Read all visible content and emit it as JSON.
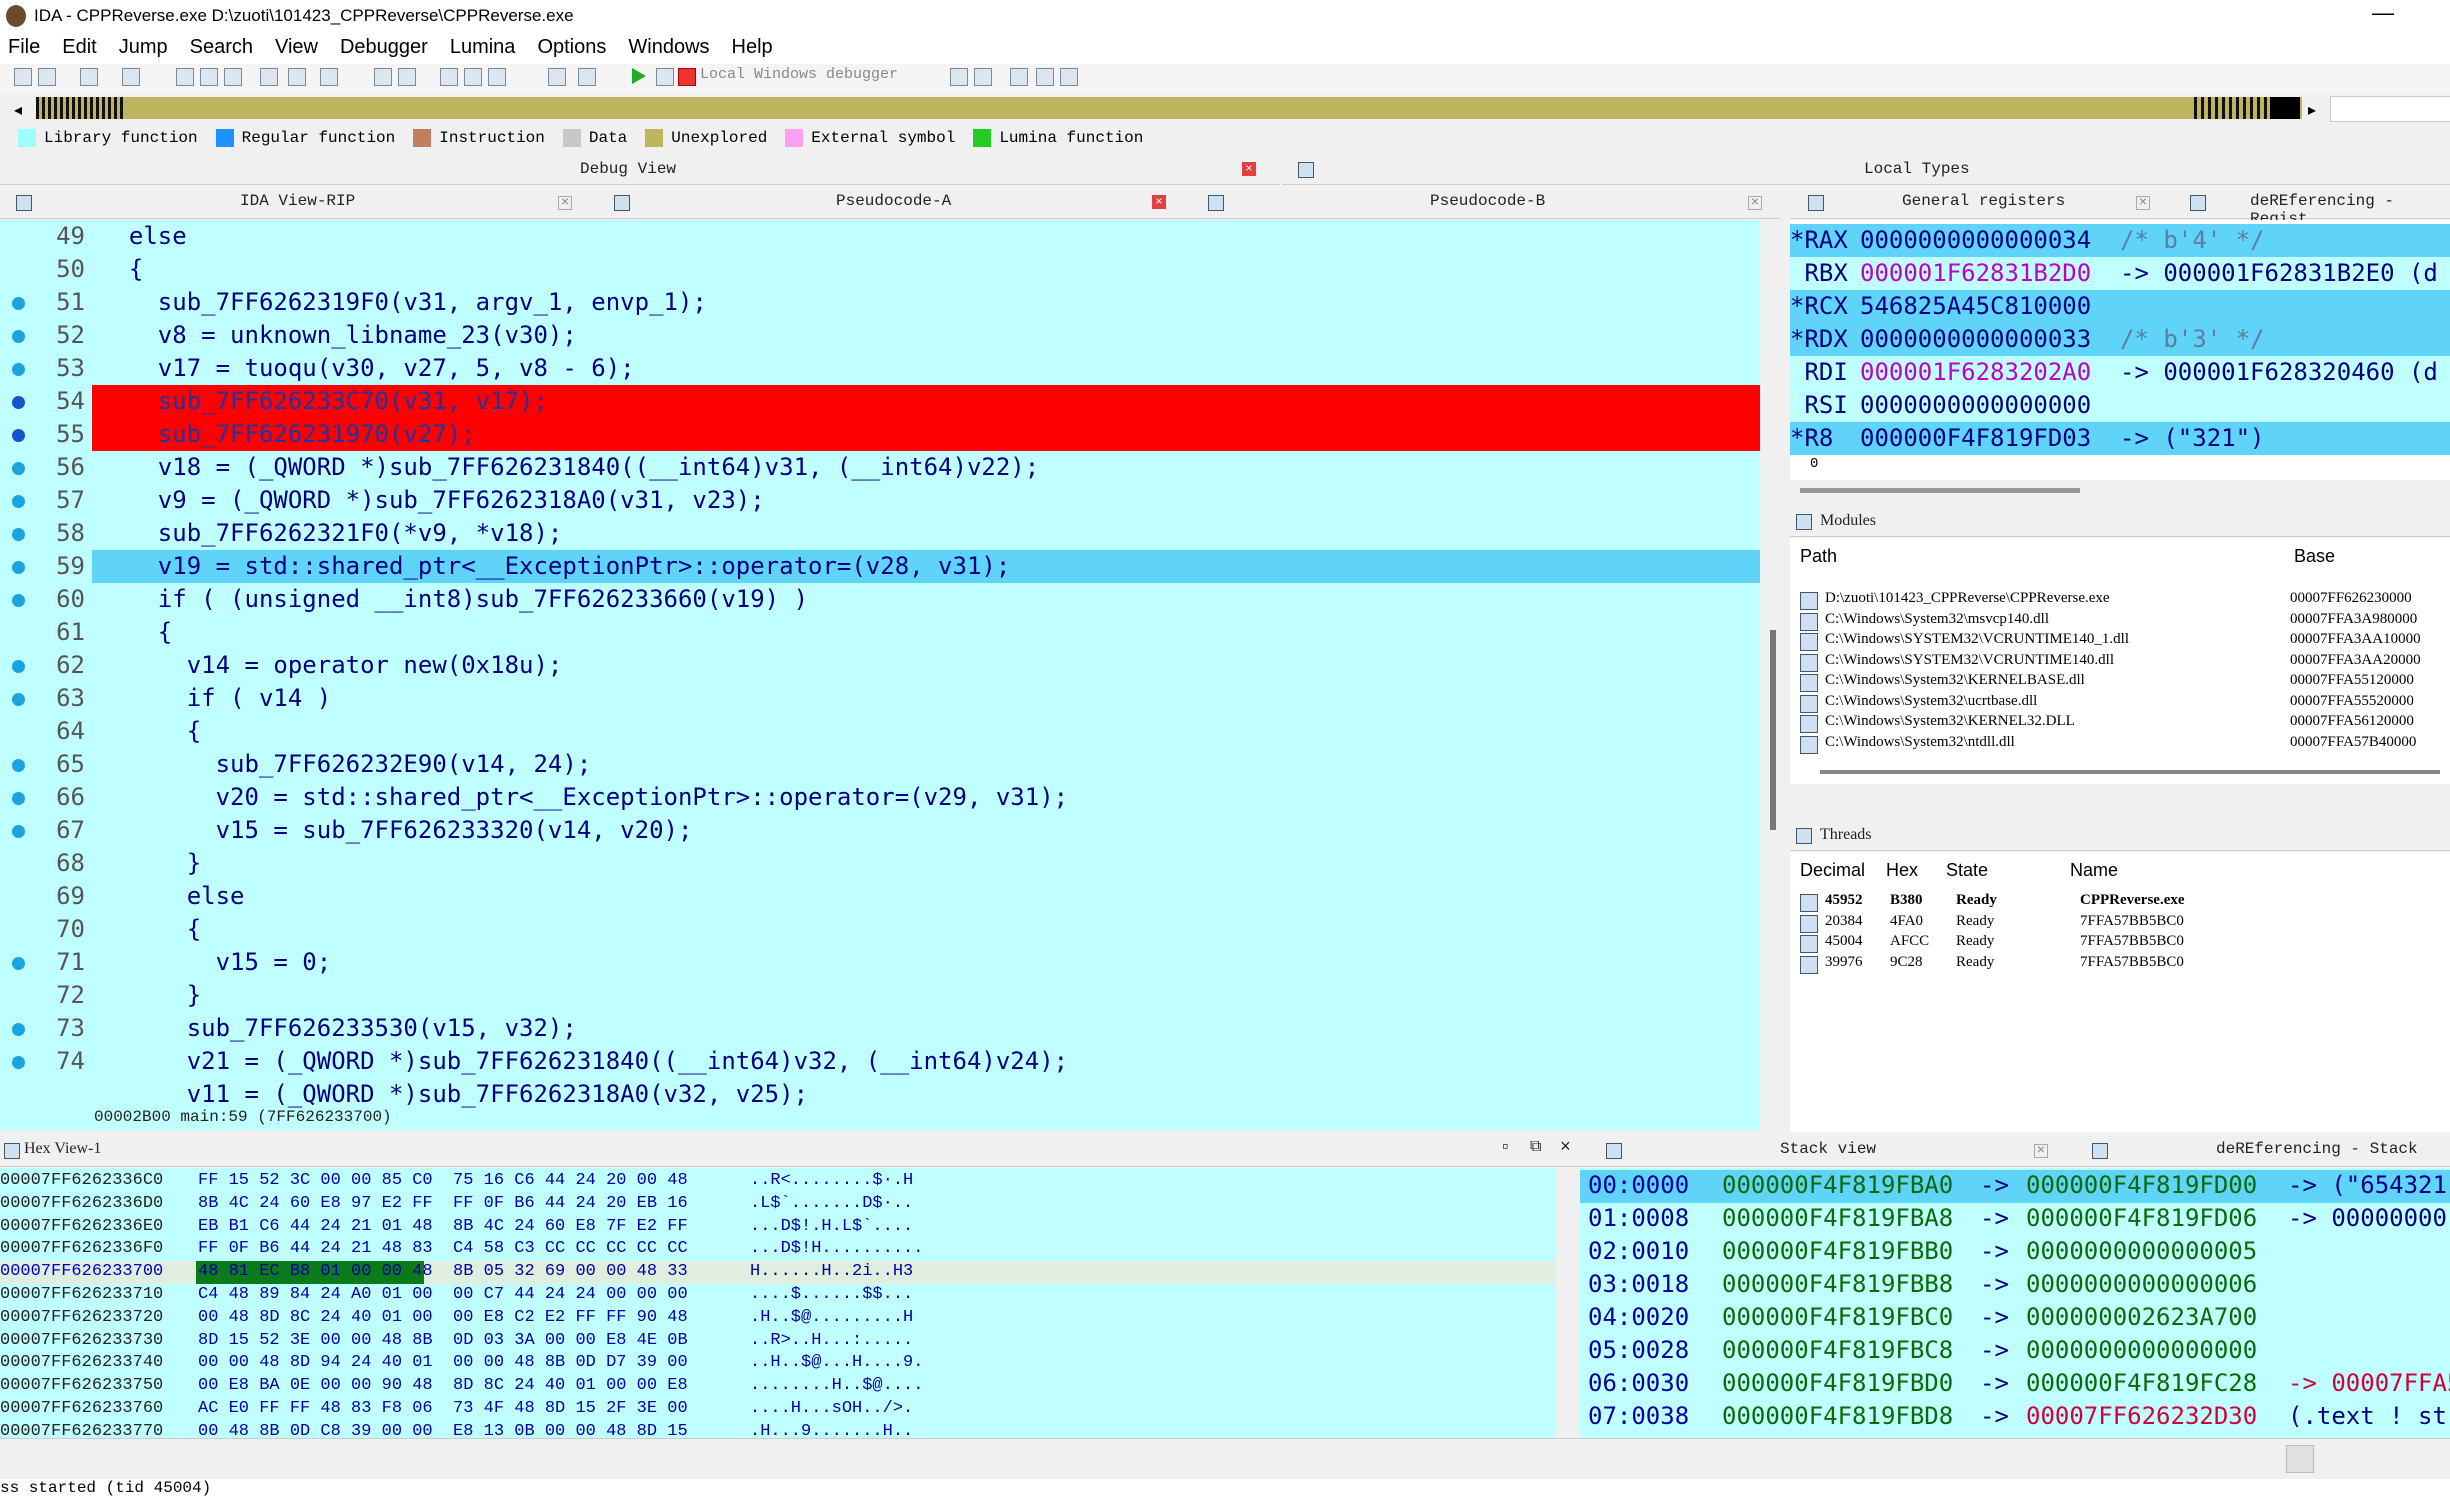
{
  "window": {
    "title": "IDA - CPPReverse.exe D:\\zuoti\\101423_CPPReverse\\CPPReverse.exe",
    "minimize": "—"
  },
  "menu": [
    "File",
    "Edit",
    "Jump",
    "Search",
    "View",
    "Debugger",
    "Lumina",
    "Options",
    "Windows",
    "Help"
  ],
  "toolbar": {
    "debugger": "Local Windows debugger"
  },
  "legend": [
    {
      "label": "Library function",
      "color": "#a0ffff"
    },
    {
      "label": "Regular function",
      "color": "#1e90ff"
    },
    {
      "label": "Instruction",
      "color": "#c08060"
    },
    {
      "label": "Data",
      "color": "#c8c8c8"
    },
    {
      "label": "Unexplored",
      "color": "#bfb55e"
    },
    {
      "label": "External symbol",
      "color": "#ff9ff0"
    },
    {
      "label": "Lumina function",
      "color": "#22cc22"
    }
  ],
  "panes": {
    "debug_view": "Debug View",
    "local_types": "Local Types",
    "ida_view": "IDA View-RIP",
    "pseudo_a": "Pseudocode-A",
    "pseudo_b": "Pseudocode-B",
    "gen_regs": "General registers",
    "deref_regs": "deREferencing - Regist",
    "modules": "Modules",
    "threads": "Threads",
    "hex": "Hex View-1",
    "stack": "Stack view",
    "deref_stack": "deREferencing - Stack"
  },
  "code": {
    "status": "00002B00 main:59 (7FF626233700)",
    "lines": [
      {
        "n": "49",
        "t": "  else",
        "dot": false,
        "hl": ""
      },
      {
        "n": "50",
        "t": "  {",
        "dot": false,
        "hl": ""
      },
      {
        "n": "51",
        "t": "    sub_7FF6262319F0(v31, argv_1, envp_1);",
        "dot": true,
        "hl": ""
      },
      {
        "n": "52",
        "t": "    v8 = unknown_libname_23(v30);",
        "dot": true,
        "hl": ""
      },
      {
        "n": "53",
        "t": "    v17 = tuoqu(v30, v27, 5, v8 - 6);",
        "dot": true,
        "hl": ""
      },
      {
        "n": "54",
        "t": "    sub_7FF626233C70(v31, v17);",
        "dot": true,
        "hl": "bp"
      },
      {
        "n": "55",
        "t": "    sub_7FF626231970(v27);",
        "dot": true,
        "hl": "bp"
      },
      {
        "n": "56",
        "t": "    v18 = (_QWORD *)sub_7FF626231840((__int64)v31, (__int64)v22);",
        "dot": true,
        "hl": ""
      },
      {
        "n": "57",
        "t": "    v9 = (_QWORD *)sub_7FF6262318A0(v31, v23);",
        "dot": true,
        "hl": ""
      },
      {
        "n": "58",
        "t": "    sub_7FF6262321F0(*v9, *v18);",
        "dot": true,
        "hl": ""
      },
      {
        "n": "59",
        "t": "    v19 = std::shared_ptr<__ExceptionPtr>::operator=(v28, v31);",
        "dot": true,
        "hl": "cur"
      },
      {
        "n": "60",
        "t": "    if ( (unsigned __int8)sub_7FF626233660(v19) )",
        "dot": true,
        "hl": ""
      },
      {
        "n": "61",
        "t": "    {",
        "dot": false,
        "hl": ""
      },
      {
        "n": "62",
        "t": "      v14 = operator new(0x18u);",
        "dot": true,
        "hl": ""
      },
      {
        "n": "63",
        "t": "      if ( v14 )",
        "dot": true,
        "hl": ""
      },
      {
        "n": "64",
        "t": "      {",
        "dot": false,
        "hl": ""
      },
      {
        "n": "65",
        "t": "        sub_7FF626232E90(v14, 24);",
        "dot": true,
        "hl": ""
      },
      {
        "n": "66",
        "t": "        v20 = std::shared_ptr<__ExceptionPtr>::operator=(v29, v31);",
        "dot": true,
        "hl": ""
      },
      {
        "n": "67",
        "t": "        v15 = sub_7FF626233320(v14, v20);",
        "dot": true,
        "hl": ""
      },
      {
        "n": "68",
        "t": "      }",
        "dot": false,
        "hl": ""
      },
      {
        "n": "69",
        "t": "      else",
        "dot": false,
        "hl": ""
      },
      {
        "n": "70",
        "t": "      {",
        "dot": false,
        "hl": ""
      },
      {
        "n": "71",
        "t": "        v15 = 0;",
        "dot": true,
        "hl": ""
      },
      {
        "n": "72",
        "t": "      }",
        "dot": false,
        "hl": ""
      },
      {
        "n": "73",
        "t": "      sub_7FF626233530(v15, v32);",
        "dot": true,
        "hl": ""
      },
      {
        "n": "74",
        "t": "      v21 = (_QWORD *)sub_7FF626231840((__int64)v32, (__int64)v24);",
        "dot": true,
        "hl": ""
      },
      {
        "n": "",
        "t": "      v11 = (_QWORD *)sub_7FF6262318A0(v32, v25);",
        "dot": false,
        "hl": ""
      }
    ]
  },
  "registers": [
    {
      "name": "*RAX",
      "value": "0000000000000034",
      "extra": "/* b'4' */",
      "changed": true
    },
    {
      "name": " RBX",
      "value": "000001F62831B2D0",
      "extra": "-> 000001F62831B2E0 (d",
      "changed": false
    },
    {
      "name": "*RCX",
      "value": "546825A45C810000",
      "extra": "",
      "changed": true
    },
    {
      "name": "*RDX",
      "value": "0000000000000033",
      "extra": "/* b'3' */",
      "changed": true
    },
    {
      "name": " RDI",
      "value": "000001F6283202A0",
      "extra": "-> 000001F628320460 (d",
      "changed": false
    },
    {
      "name": " RSI",
      "value": "0000000000000000",
      "extra": "",
      "changed": false
    },
    {
      "name": "*R8",
      "value": "000000F4F819FD03",
      "extra": "-> (\"321\")",
      "changed": true
    }
  ],
  "reg_footer": "0",
  "modules": {
    "headers": [
      "Path",
      "Base"
    ],
    "rows": [
      {
        "path": "D:\\zuoti\\101423_CPPReverse\\CPPReverse.exe",
        "base": "00007FF626230000"
      },
      {
        "path": "C:\\Windows\\System32\\msvcp140.dll",
        "base": "00007FFA3A980000"
      },
      {
        "path": "C:\\Windows\\SYSTEM32\\VCRUNTIME140_1.dll",
        "base": "00007FFA3AA10000"
      },
      {
        "path": "C:\\Windows\\SYSTEM32\\VCRUNTIME140.dll",
        "base": "00007FFA3AA20000"
      },
      {
        "path": "C:\\Windows\\System32\\KERNELBASE.dll",
        "base": "00007FFA55120000"
      },
      {
        "path": "C:\\Windows\\System32\\ucrtbase.dll",
        "base": "00007FFA55520000"
      },
      {
        "path": "C:\\Windows\\System32\\KERNEL32.DLL",
        "base": "00007FFA56120000"
      },
      {
        "path": "C:\\Windows\\System32\\ntdll.dll",
        "base": "00007FFA57B40000"
      }
    ]
  },
  "threads": {
    "headers": [
      "Decimal",
      "Hex",
      "State",
      "Name"
    ],
    "rows": [
      {
        "dec": "45952",
        "hex": "B380",
        "state": "Ready",
        "name": "CPPReverse.exe",
        "bold": true
      },
      {
        "dec": "20384",
        "hex": "4FA0",
        "state": "Ready",
        "name": "7FFA57BB5BC0",
        "bold": false
      },
      {
        "dec": "45004",
        "hex": "AFCC",
        "state": "Ready",
        "name": "7FFA57BB5BC0",
        "bold": false
      },
      {
        "dec": "39976",
        "hex": "9C28",
        "state": "Ready",
        "name": "7FFA57BB5BC0",
        "bold": false
      }
    ]
  },
  "hex": [
    {
      "addr": "00007FF6262336C0",
      "bytes": "FF 15 52 3C 00 00 85 C0  75 16 C6 44 24 20 00 48",
      "ascii": "..R<........$·.H"
    },
    {
      "addr": "00007FF6262336D0",
      "bytes": "8B 4C 24 60 E8 97 E2 FF  FF 0F B6 44 24 20 EB 16",
      "ascii": ".L$`.......D$·.."
    },
    {
      "addr": "00007FF6262336E0",
      "bytes": "EB B1 C6 44 24 21 01 48  8B 4C 24 60 E8 7F E2 FF",
      "ascii": "...D$!.H.L$`...."
    },
    {
      "addr": "00007FF6262336F0",
      "bytes": "FF 0F B6 44 24 21 48 83  C4 58 C3 CC CC CC CC CC",
      "ascii": "...D$!H.........."
    },
    {
      "addr": "00007FF626233700",
      "bytes": "48 81 EC B8 01 00 00 48  8B 05 32 69 00 00 48 33",
      "ascii": "H......H..2i..H3",
      "sel": true
    },
    {
      "addr": "00007FF626233710",
      "bytes": "C4 48 89 84 24 A0 01 00  00 C7 44 24 24 00 00 00",
      "ascii": "....$......$$..."
    },
    {
      "addr": "00007FF626233720",
      "bytes": "00 48 8D 8C 24 40 01 00  00 E8 C2 E2 FF FF 90 48",
      "ascii": ".H..$@.........H"
    },
    {
      "addr": "00007FF626233730",
      "bytes": "8D 15 52 3E 00 00 48 8B  0D 03 3A 00 00 E8 4E 0B",
      "ascii": "..R>..H...:....."
    },
    {
      "addr": "00007FF626233740",
      "bytes": "00 00 48 8D 94 24 40 01  00 00 48 8B 0D D7 39 00",
      "ascii": "..H..$@...H....9."
    },
    {
      "addr": "00007FF626233750",
      "bytes": "00 E8 BA 0E 00 00 90 48  8D 8C 24 40 01 00 00 E8",
      "ascii": "........H..$@...."
    },
    {
      "addr": "00007FF626233760",
      "bytes": "AC E0 FF FF 48 83 F8 06  73 4F 48 8D 15 2F 3E 00",
      "ascii": "....H...sOH../>."
    },
    {
      "addr": "00007FF626233770",
      "bytes": "00 48 8B 0D C8 39 00 00  E8 13 0B 00 00 48 8D 15",
      "ascii": ".H...9.......H.."
    }
  ],
  "stack": [
    {
      "idx": "00:0000",
      "addr": "000000F4F819FBA0",
      "arrow": "->",
      "val": "000000F4F819FD00",
      "tail": "-> (\"654321'",
      "cur": true
    },
    {
      "idx": "01:0008",
      "addr": "000000F4F819FBA8",
      "arrow": "->",
      "val": "000000F4F819FD06",
      "tail": "-> 00000000"
    },
    {
      "idx": "02:0010",
      "addr": "000000F4F819FBB0",
      "arrow": "->",
      "val": "0000000000000005",
      "tail": ""
    },
    {
      "idx": "03:0018",
      "addr": "000000F4F819FBB8",
      "arrow": "->",
      "val": "0000000000000006",
      "tail": ""
    },
    {
      "idx": "04:0020",
      "addr": "000000F4F819FBC0",
      "arrow": "->",
      "val": "000000002623A700",
      "tail": ""
    },
    {
      "idx": "05:0028",
      "addr": "000000F4F819FBC8",
      "arrow": "->",
      "val": "0000000000000000",
      "tail": ""
    },
    {
      "idx": "06:0030",
      "addr": "000000F4F819FBD0",
      "arrow": "->",
      "val": "000000F4F819FC28",
      "tail": "-> 00007FFA5"
    },
    {
      "idx": "07:0038",
      "addr": "000000F4F819FBD8",
      "arrow": "->",
      "val": "00007FF626232D30",
      "tail": "(.text ! st"
    }
  ],
  "output": {
    "line": "ss started (tid 45004)"
  }
}
